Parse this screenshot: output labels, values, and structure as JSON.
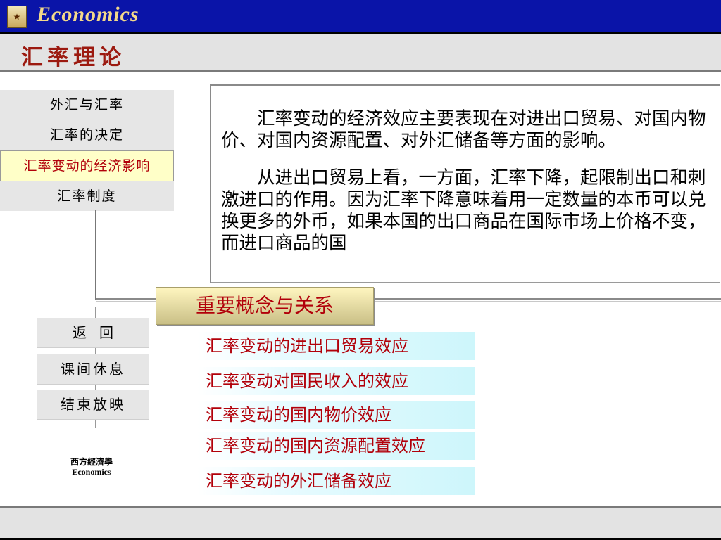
{
  "header": {
    "brand": "Economics",
    "logo_icon": "book-icon",
    "colors": {
      "bar": "#0a14a8",
      "brand_text": "#f3d98a",
      "accent_red": "#b2000a"
    }
  },
  "title": "汇率理论",
  "nav": {
    "items": [
      {
        "label": "外汇与汇率"
      },
      {
        "label": "汇率的决定"
      },
      {
        "label": "汇率变动的经济影响"
      },
      {
        "label": "汇率制度"
      }
    ],
    "active_index": 2
  },
  "panel": {
    "paragraphs": [
      "汇率变动的经济效应主要表现在对进出口贸易、对国内物价、对国内资源配置、对外汇储备等方面的影响。",
      "从进出口贸易上看，一方面，汇率下降，起限制出口和刺激进口的作用。因为汇率下降意味着用一定数量的本币可以兑换更多的外币，如果本国的出口商品在国际市场上价格不变，而进口商品的国"
    ]
  },
  "concepts": {
    "header": "重要概念与关系",
    "items": [
      "汇率变动的进出口贸易效应",
      "汇率变动对国民收入的效应",
      "汇率变动的国内物价效应",
      "汇率变动的国内资源配置效应",
      "汇率变动的外汇储备效应"
    ]
  },
  "buttons": {
    "back": "返回",
    "break": "课间休息",
    "end": "结束放映"
  },
  "footer_logo": {
    "line1": "西方經濟學",
    "line2": "Economics"
  }
}
